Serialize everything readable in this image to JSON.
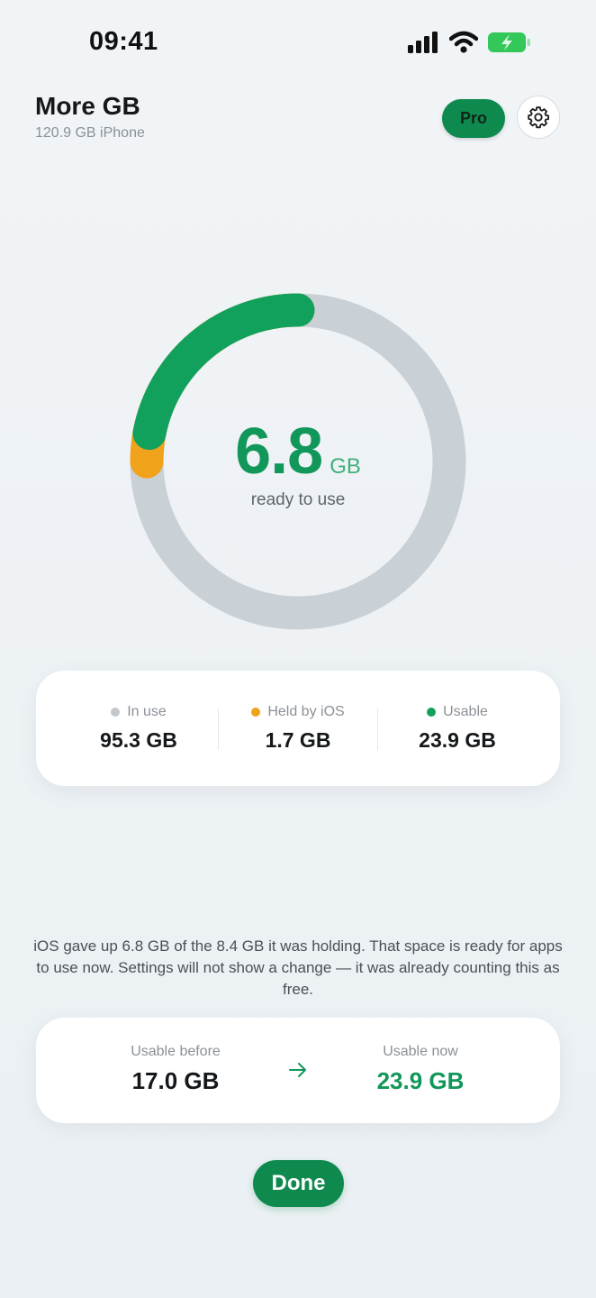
{
  "status_bar": {
    "time": "09:41",
    "icons": [
      "cellular-signal-icon",
      "wifi-icon",
      "battery-charging-icon"
    ],
    "battery_color": "#34c759"
  },
  "header": {
    "title": "More GB",
    "subtitle": "120.9 GB iPhone",
    "pro_label": "Pro",
    "settings_icon": "gear-icon"
  },
  "ring": {
    "value": "6.8",
    "unit": "GB",
    "caption": "ready to use",
    "green_fraction": 0.22,
    "orange_fraction": 0.03,
    "colors": {
      "track": "#c9d0d6",
      "green": "#12a15d",
      "orange": "#f0a21a"
    }
  },
  "stats": [
    {
      "label": "In use",
      "value": "95.3 GB",
      "dot_color": "#c3c8cd"
    },
    {
      "label": "Held by iOS",
      "value": "1.7 GB",
      "dot_color": "#f0a21a"
    },
    {
      "label": "Usable",
      "value": "23.9 GB",
      "dot_color": "#12a15d"
    }
  ],
  "message": "iOS gave up 6.8 GB of the 8.4 GB it was holding. That space is ready for apps to use now. Settings will not show a change — it was already counting this as free.",
  "compare": {
    "before_label": "Usable before",
    "before_value": "17.0 GB",
    "now_label": "Usable now",
    "now_value": "23.9 GB",
    "arrow_icon": "arrow-right-icon",
    "accent": "#12975a"
  },
  "done_label": "Done"
}
